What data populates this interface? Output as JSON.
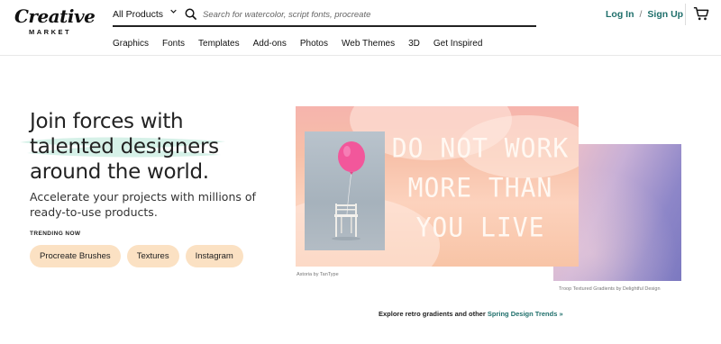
{
  "brand": {
    "logo_line1": "Creative",
    "logo_line2": "MARKET"
  },
  "search": {
    "category": "All Products",
    "placeholder": "Search for watercolor, script fonts, procreate"
  },
  "nav": [
    "Graphics",
    "Fonts",
    "Templates",
    "Add-ons",
    "Photos",
    "Web Themes",
    "3D",
    "Get Inspired"
  ],
  "auth": {
    "login": "Log In",
    "separator": "/",
    "signup": "Sign Up"
  },
  "hero": {
    "headline": [
      "Join forces with",
      "talented designers",
      "around the world."
    ],
    "subhead": [
      "Accelerate your projects with millions of",
      "ready-to-use products."
    ],
    "trending_label": "TRENDING NOW",
    "trending": [
      "Procreate Brushes",
      "Textures",
      "Instagram"
    ]
  },
  "feature": {
    "poster_lines": [
      "DO NOT WORK",
      "MORE THAN",
      "YOU LIVE"
    ],
    "caption_front": "Astoria by TanType",
    "caption_back": "Troop Textured Gradients by Delightful Design",
    "explore_prefix": "Explore retro gradients and other ",
    "explore_link": "Spring Design Trends »"
  },
  "colors": {
    "accent": "#1f6f6b",
    "pill": "#fbe1c3"
  },
  "icons": [
    "chevron-down-icon",
    "search-icon",
    "cart-icon"
  ]
}
